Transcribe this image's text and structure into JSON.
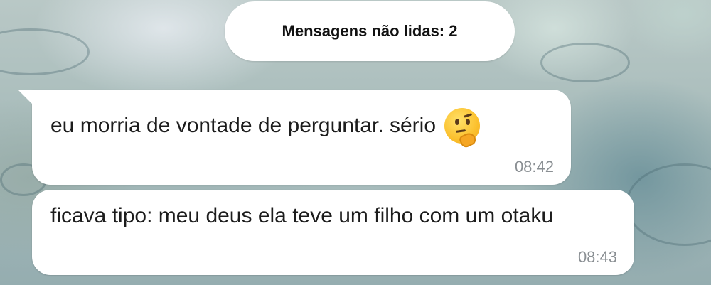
{
  "chat": {
    "unread_banner": "Mensagens não lidas: 2",
    "messages": [
      {
        "text": "eu morria de vontade de perguntar. sério",
        "emoji": "thinking-face-icon",
        "time": "08:42"
      },
      {
        "text": "ficava tipo: meu deus ela teve um filho com um otaku",
        "time": "08:43"
      }
    ]
  },
  "colors": {
    "bubble_background": "#ffffff",
    "timestamp_color": "#8a8f93",
    "text_color": "#1c1c1c"
  }
}
